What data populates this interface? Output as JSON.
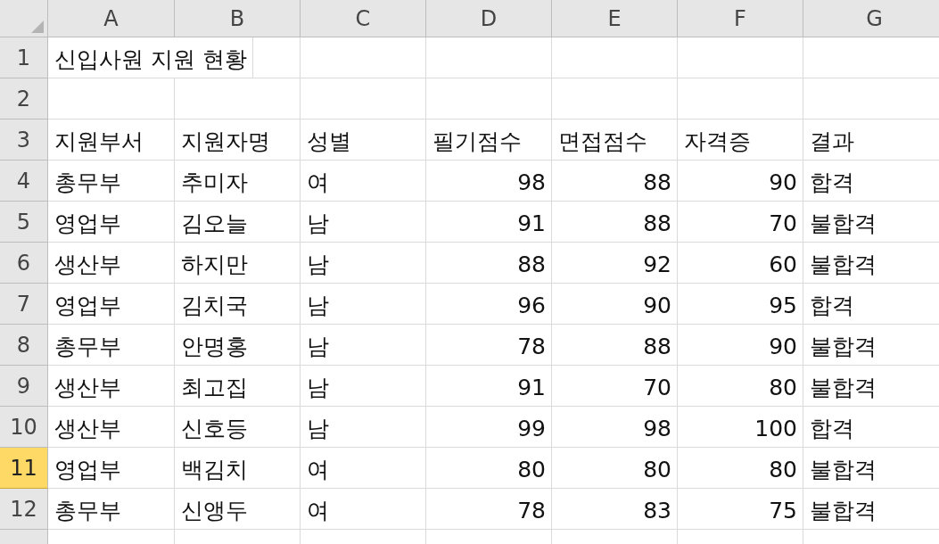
{
  "columns": [
    {
      "label": "A",
      "selected": false
    },
    {
      "label": "B",
      "selected": false
    },
    {
      "label": "C",
      "selected": false
    },
    {
      "label": "D",
      "selected": false
    },
    {
      "label": "E",
      "selected": false
    },
    {
      "label": "F",
      "selected": false
    },
    {
      "label": "G",
      "selected": false
    }
  ],
  "rows": [
    {
      "header": "1",
      "selected": false,
      "cells": [
        {
          "text": "신입사원 지원 현황",
          "kind": "text"
        }
      ]
    },
    {
      "header": "2",
      "selected": false
    },
    {
      "header": "3",
      "selected": false,
      "cells": [
        {
          "text": "지원부서",
          "kind": "text"
        },
        {
          "text": "지원자명",
          "kind": "text"
        },
        {
          "text": "성별",
          "kind": "text"
        },
        {
          "text": "필기점수",
          "kind": "text"
        },
        {
          "text": "면접점수",
          "kind": "text"
        },
        {
          "text": "자격증",
          "kind": "text"
        },
        {
          "text": "결과",
          "kind": "text"
        }
      ]
    },
    {
      "header": "4",
      "selected": false,
      "cells": [
        {
          "text": "총무부",
          "kind": "text"
        },
        {
          "text": "추미자",
          "kind": "text"
        },
        {
          "text": "여",
          "kind": "text"
        },
        {
          "text": "98",
          "kind": "number"
        },
        {
          "text": "88",
          "kind": "number"
        },
        {
          "text": "90",
          "kind": "number"
        },
        {
          "text": "합격",
          "kind": "text"
        }
      ]
    },
    {
      "header": "5",
      "selected": false,
      "cells": [
        {
          "text": "영업부",
          "kind": "text"
        },
        {
          "text": "김오늘",
          "kind": "text"
        },
        {
          "text": "남",
          "kind": "text"
        },
        {
          "text": "91",
          "kind": "number"
        },
        {
          "text": "88",
          "kind": "number"
        },
        {
          "text": "70",
          "kind": "number"
        },
        {
          "text": "불합격",
          "kind": "text"
        }
      ]
    },
    {
      "header": "6",
      "selected": false,
      "cells": [
        {
          "text": "생산부",
          "kind": "text"
        },
        {
          "text": "하지만",
          "kind": "text"
        },
        {
          "text": "남",
          "kind": "text"
        },
        {
          "text": "88",
          "kind": "number"
        },
        {
          "text": "92",
          "kind": "number"
        },
        {
          "text": "60",
          "kind": "number"
        },
        {
          "text": "불합격",
          "kind": "text"
        }
      ]
    },
    {
      "header": "7",
      "selected": false,
      "cells": [
        {
          "text": "영업부",
          "kind": "text"
        },
        {
          "text": "김치국",
          "kind": "text"
        },
        {
          "text": "남",
          "kind": "text"
        },
        {
          "text": "96",
          "kind": "number"
        },
        {
          "text": "90",
          "kind": "number"
        },
        {
          "text": "95",
          "kind": "number"
        },
        {
          "text": "합격",
          "kind": "text"
        }
      ]
    },
    {
      "header": "8",
      "selected": false,
      "cells": [
        {
          "text": "총무부",
          "kind": "text"
        },
        {
          "text": "안명홍",
          "kind": "text"
        },
        {
          "text": "남",
          "kind": "text"
        },
        {
          "text": "78",
          "kind": "number"
        },
        {
          "text": "88",
          "kind": "number"
        },
        {
          "text": "90",
          "kind": "number"
        },
        {
          "text": "불합격",
          "kind": "text"
        }
      ]
    },
    {
      "header": "9",
      "selected": false,
      "cells": [
        {
          "text": "생산부",
          "kind": "text"
        },
        {
          "text": "최고집",
          "kind": "text"
        },
        {
          "text": "남",
          "kind": "text"
        },
        {
          "text": "91",
          "kind": "number"
        },
        {
          "text": "70",
          "kind": "number"
        },
        {
          "text": "80",
          "kind": "number"
        },
        {
          "text": "불합격",
          "kind": "text"
        }
      ]
    },
    {
      "header": "10",
      "selected": false,
      "cells": [
        {
          "text": "생산부",
          "kind": "text"
        },
        {
          "text": "신호등",
          "kind": "text"
        },
        {
          "text": "남",
          "kind": "text"
        },
        {
          "text": "99",
          "kind": "number"
        },
        {
          "text": "98",
          "kind": "number"
        },
        {
          "text": "100",
          "kind": "number"
        },
        {
          "text": "합격",
          "kind": "text"
        }
      ]
    },
    {
      "header": "11",
      "selected": true,
      "cells": [
        {
          "text": "영업부",
          "kind": "text"
        },
        {
          "text": "백김치",
          "kind": "text"
        },
        {
          "text": "여",
          "kind": "text"
        },
        {
          "text": "80",
          "kind": "number"
        },
        {
          "text": "80",
          "kind": "number"
        },
        {
          "text": "80",
          "kind": "number"
        },
        {
          "text": "불합격",
          "kind": "text"
        }
      ]
    },
    {
      "header": "12",
      "selected": false,
      "cells": [
        {
          "text": "총무부",
          "kind": "text"
        },
        {
          "text": "신앵두",
          "kind": "text"
        },
        {
          "text": "여",
          "kind": "text"
        },
        {
          "text": "78",
          "kind": "number"
        },
        {
          "text": "83",
          "kind": "number"
        },
        {
          "text": "75",
          "kind": "number"
        },
        {
          "text": "불합격",
          "kind": "text"
        }
      ]
    }
  ]
}
